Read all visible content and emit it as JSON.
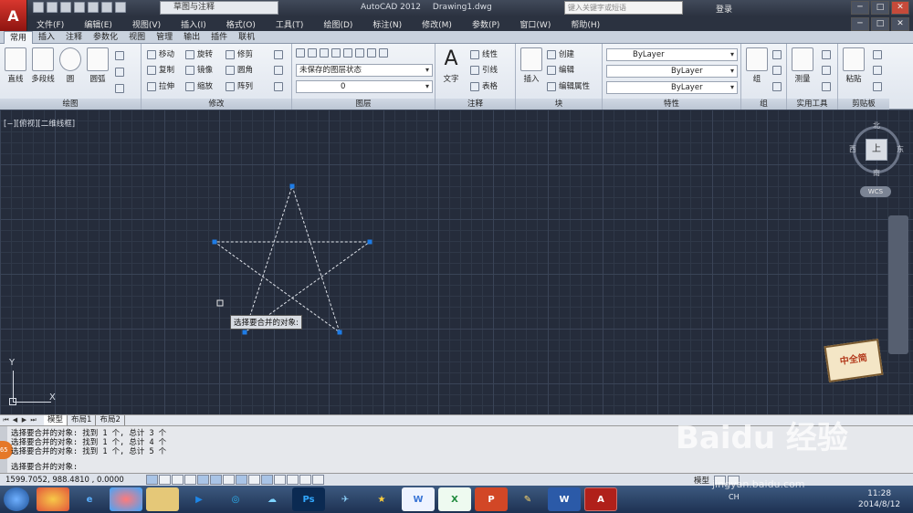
{
  "titlebar": {
    "app_name": "AutoCAD 2012",
    "doc_name": "Drawing1.dwg",
    "workspace": "草图与注释",
    "search_placeholder": "键入关键字或短语",
    "login": "登录",
    "win_minimize": "─",
    "win_restore": "□",
    "win_close": "✕"
  },
  "menubar": {
    "items": [
      "文件(F)",
      "编辑(E)",
      "视图(V)",
      "插入(I)",
      "格式(O)",
      "工具(T)",
      "绘图(D)",
      "标注(N)",
      "修改(M)",
      "参数(P)",
      "窗口(W)",
      "帮助(H)"
    ]
  },
  "ribbon_tabs": [
    "常用",
    "插入",
    "注释",
    "参数化",
    "视图",
    "管理",
    "输出",
    "插件",
    "联机"
  ],
  "ribbon": {
    "draw": {
      "title": "绘图",
      "line": "直线",
      "polyline": "多段线",
      "circle": "圆",
      "arc": "圆弧"
    },
    "modify": {
      "title": "修改",
      "move": "移动",
      "rotate": "旋转",
      "trim": "修剪",
      "copy": "复制",
      "mirror": "镜像",
      "fillet": "圆角",
      "stretch": "拉伸",
      "scale": "缩放",
      "array": "阵列"
    },
    "layers": {
      "title": "图层",
      "layer_state": "未保存的图层状态",
      "current_layer": "0"
    },
    "annotation": {
      "title": "注释",
      "text": "文字",
      "linear": "线性",
      "leader": "引线",
      "table": "表格"
    },
    "block": {
      "title": "块",
      "insert": "插入",
      "create": "创建",
      "edit": "编辑",
      "edit_attr": "编辑属性"
    },
    "properties": {
      "title": "特性",
      "color": "ByLayer",
      "lineweight": "ByLayer",
      "linetype": "ByLayer"
    },
    "groups": {
      "title": "组",
      "group": "组"
    },
    "utilities": {
      "title": "实用工具",
      "measure": "测量"
    },
    "clipboard": {
      "title": "剪贴板",
      "paste": "粘贴"
    }
  },
  "canvas": {
    "viewport_label": "[−][俯视][二维线框]",
    "tooltip": "选择要合并的对象:",
    "viewcube_face": "上",
    "compass": {
      "n": "北",
      "s": "南",
      "e": "东",
      "w": "西"
    },
    "wcs": "WCS",
    "ucs_x": "X",
    "ucs_y": "Y"
  },
  "layout_tabs": [
    "模型",
    "布局1",
    "布局2"
  ],
  "command": {
    "history": [
      "选择要合并的对象: 找到 1 个, 总计 3 个",
      "选择要合并的对象: 找到 1 个, 总计 4 个",
      "选择要合并的对象: 找到 1 个, 总计 5 个"
    ],
    "prompt": "选择要合并的对象:"
  },
  "statusbar": {
    "coords": "1599.7052, 988.4810 , 0.0000",
    "model": "模型"
  },
  "taskbar": {
    "tray_lang": "CH",
    "time": "11:28",
    "date": "2014/8/12"
  },
  "overlay": {
    "baidu": "Baidu 经验",
    "baidu_sub": "jingyan.baidu.com",
    "sticker": "中全简",
    "badge": "65"
  }
}
